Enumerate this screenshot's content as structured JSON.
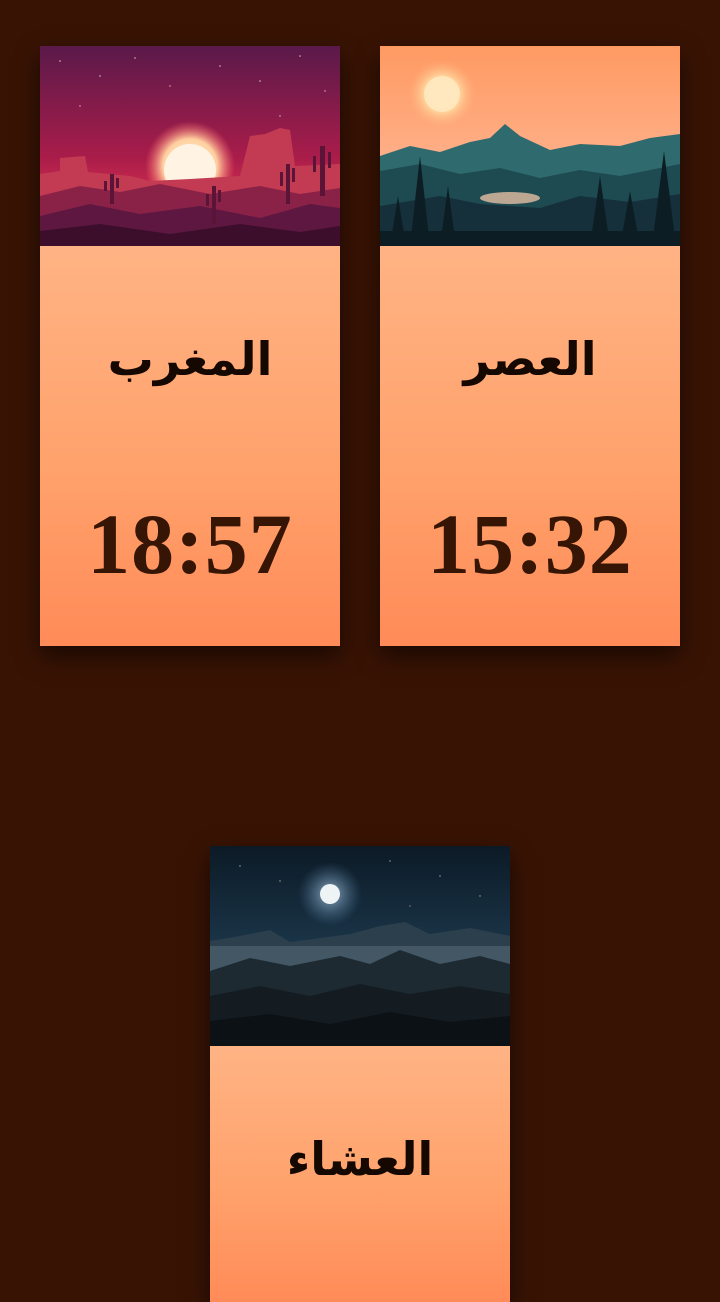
{
  "prayers": [
    {
      "name": "المغرب",
      "time": "18:57",
      "scene": "desert-sunset-illustration"
    },
    {
      "name": "العصر",
      "time": "15:32",
      "scene": "mountain-lake-afternoon-illustration"
    },
    {
      "name": "العشاء",
      "time": "",
      "scene": "moonlit-mountains-night-illustration"
    }
  ],
  "colors": {
    "background": "#381304",
    "card_gradient_top": "#ffb384",
    "card_gradient_bottom": "#ff8b58",
    "time_text": "#361505",
    "name_text": "#140800"
  }
}
